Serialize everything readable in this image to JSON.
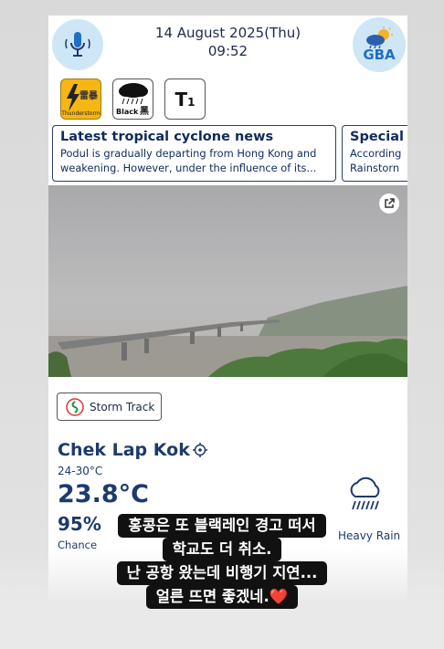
{
  "header": {
    "date": "14 August 2025(Thu)",
    "time": "09:52",
    "gba_label": "GBA"
  },
  "warnings": {
    "thunderstorm": {
      "cn": "雷暴",
      "en": "Thunderstorm"
    },
    "black_rain": {
      "en": "Black",
      "cn": "黑"
    },
    "typhoon": {
      "label": "T",
      "number": "1"
    }
  },
  "news": [
    {
      "title": "Latest tropical cyclone news",
      "body": "Podul is gradually departing from Hong Kong and weakening. However, under the influence of its..."
    },
    {
      "title": "Special",
      "body": "According Rainstorn"
    }
  ],
  "storm_track": {
    "label": "Storm Track"
  },
  "location": {
    "name": "Chek Lap Kok",
    "temp_range": "24-30°C",
    "temperature": "23.8°C",
    "humidity": "95%",
    "chance_label": "Chance",
    "condition": "Heavy Rain"
  },
  "caption": {
    "line1": "홍콩은 또 블랙레인 경고 떠서",
    "line2": "학교도 더 취소.",
    "line3": "난 공항 왔는데 비행기 지연...",
    "line4": "얼른 뜨면 좋겠네.",
    "heart": "❤️"
  },
  "colors": {
    "navy": "#1c3a6e",
    "thunder_yellow": "#f6b613",
    "icon_blue": "#cfe6f7"
  },
  "icons": [
    "microphone-icon",
    "gba-weather-icon",
    "share-icon",
    "storm-track-icon",
    "target-icon",
    "heavy-rain-icon"
  ]
}
